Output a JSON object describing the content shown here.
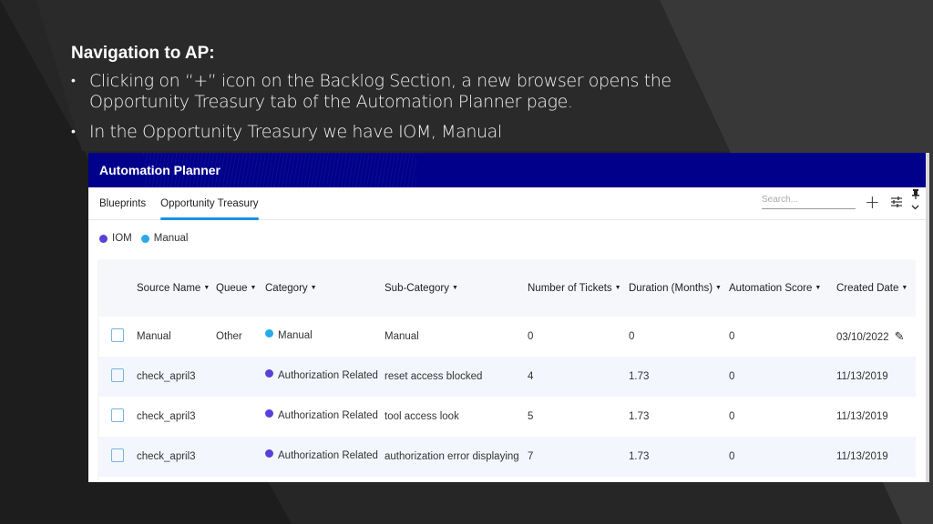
{
  "slide": {
    "heading": "Navigation to AP:",
    "bullets": [
      "Clicking on “+” icon on the Backlog Section, a new browser opens the Opportunity Treasury tab of the Automation Planner page.",
      "In the Opportunity Treasury we have IOM, Manual"
    ]
  },
  "app": {
    "title": "Automation Planner",
    "tabs": [
      {
        "label": "Blueprints",
        "active": false
      },
      {
        "label": "Opportunity Treasury",
        "active": true
      }
    ],
    "search": {
      "placeholder": "Search...",
      "value": ""
    },
    "icons": {
      "add": "plus-icon",
      "filter": "sliders-icon",
      "pin": "pin-icon",
      "expand": "chevron-down-icon"
    },
    "legend": [
      {
        "label": "IOM",
        "color": "#5b3fd9"
      },
      {
        "label": "Manual",
        "color": "#29a9ea"
      }
    ],
    "table": {
      "columns": [
        "Source Name",
        "Queue",
        "Category",
        "Sub-Category",
        "Number of Tickets",
        "Duration (Months)",
        "Automation Score",
        "Created Date"
      ],
      "rows": [
        {
          "source": "Manual",
          "queue": "Other",
          "category": "Manual",
          "category_color": "#29a9ea",
          "subcategory": "Manual",
          "tickets": "0",
          "duration": "0",
          "score": "0",
          "created": "03/10/2022",
          "editable": true
        },
        {
          "source": "check_april3",
          "queue": "",
          "category": "Authorization Related",
          "category_color": "#5b3fd9",
          "subcategory": "reset access blocked",
          "tickets": "4",
          "duration": "1.73",
          "score": "0",
          "created": "11/13/2019",
          "editable": false
        },
        {
          "source": "check_april3",
          "queue": "",
          "category": "Authorization Related",
          "category_color": "#5b3fd9",
          "subcategory": "tool access look",
          "tickets": "5",
          "duration": "1.73",
          "score": "0",
          "created": "11/13/2019",
          "editable": false
        },
        {
          "source": "check_april3",
          "queue": "",
          "category": "Authorization Related",
          "category_color": "#5b3fd9",
          "subcategory": "authorization error displaying",
          "tickets": "7",
          "duration": "1.73",
          "score": "0",
          "created": "11/13/2019",
          "editable": false
        }
      ]
    }
  }
}
